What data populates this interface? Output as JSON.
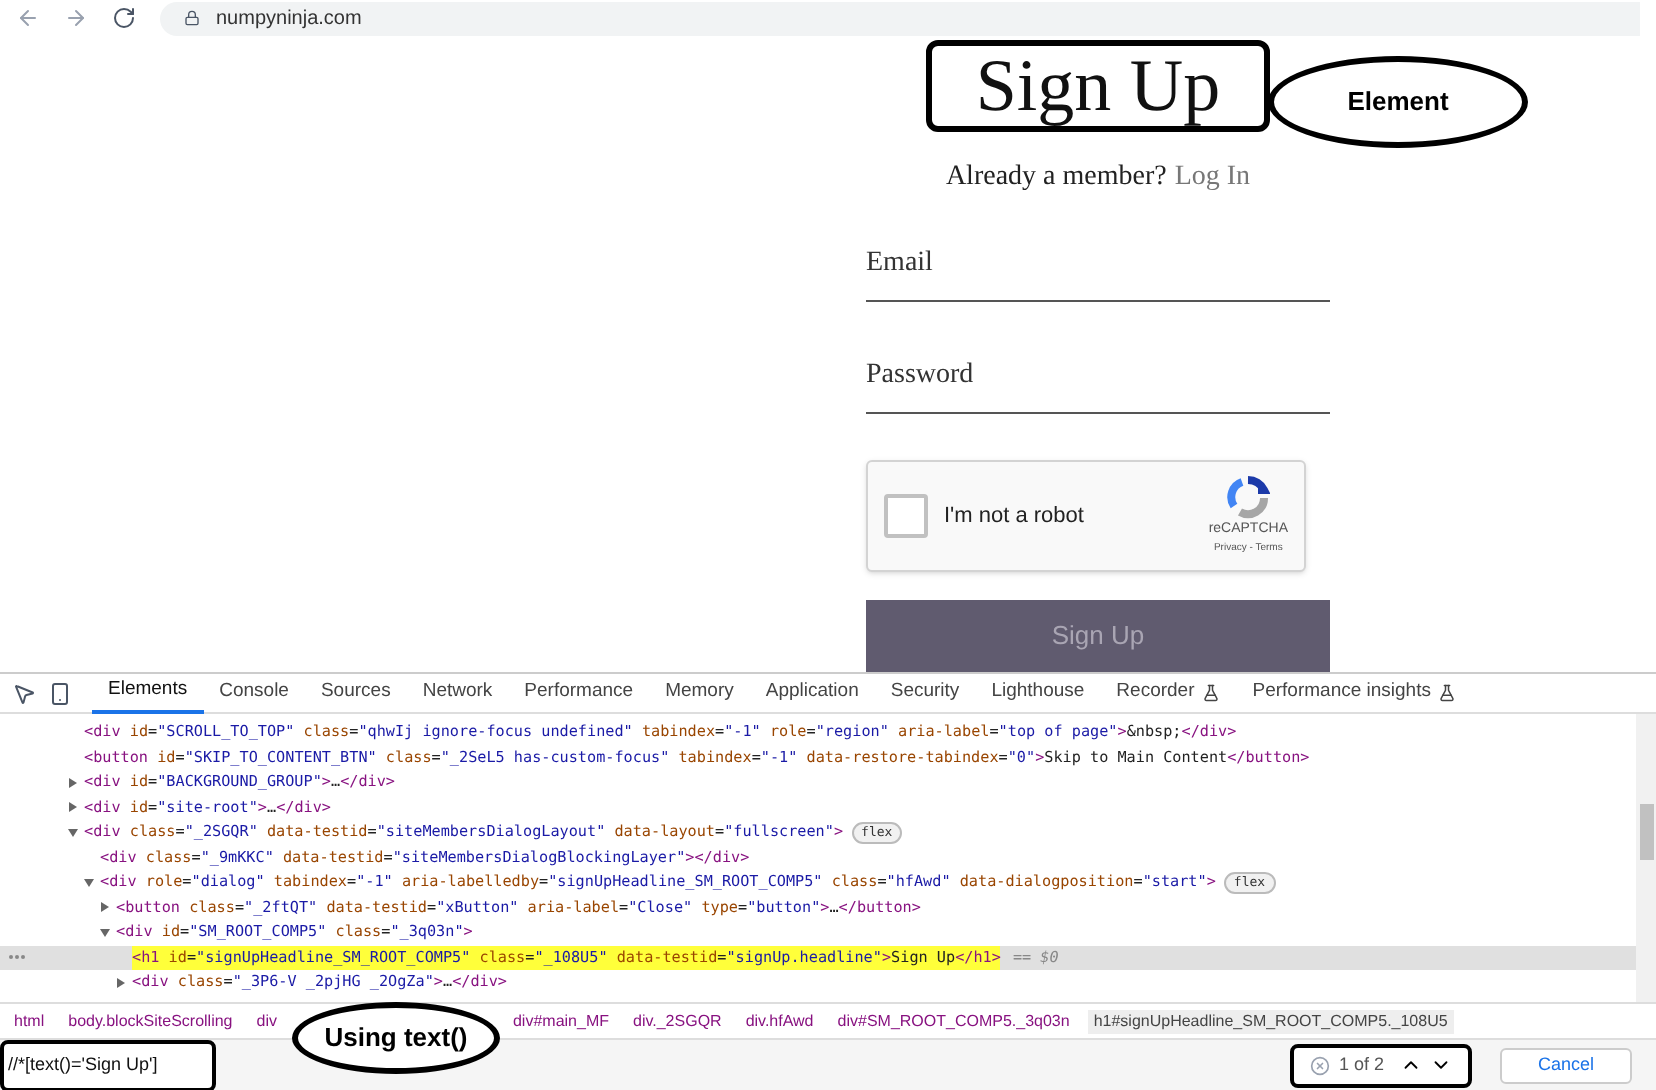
{
  "browser": {
    "url": "numpyninja.com"
  },
  "page": {
    "title": "Sign Up",
    "member_prompt": "Already a member?",
    "login_link": "Log In",
    "fields": [
      {
        "label": "Email"
      },
      {
        "label": "Password"
      }
    ],
    "captcha": {
      "label": "I'm not a robot",
      "checked": false,
      "brand": "reCAPTCHA",
      "links": "Privacy - Terms"
    },
    "submit": "Sign Up"
  },
  "devtools": {
    "tabs": [
      {
        "label": "Elements",
        "selected": true,
        "flask": false
      },
      {
        "label": "Console",
        "selected": false,
        "flask": false
      },
      {
        "label": "Sources",
        "selected": false,
        "flask": false
      },
      {
        "label": "Network",
        "selected": false,
        "flask": false
      },
      {
        "label": "Performance",
        "selected": false,
        "flask": false
      },
      {
        "label": "Memory",
        "selected": false,
        "flask": false
      },
      {
        "label": "Application",
        "selected": false,
        "flask": false
      },
      {
        "label": "Security",
        "selected": false,
        "flask": false
      },
      {
        "label": "Lighthouse",
        "selected": false,
        "flask": false
      },
      {
        "label": "Recorder",
        "selected": false,
        "flask": true
      },
      {
        "label": "Performance insights",
        "selected": false,
        "flask": true
      }
    ],
    "lines": [
      {
        "code": "<div id=\"SCROLL_TO_TOP\" class=\"qhwIj ignore-focus undefined\" tabindex=\"-1\" role=\"region\" aria-label=\"top of page\">&nbsp;</div>",
        "selected": false
      },
      {
        "code": "<button id=\"SKIP_TO_CONTENT_BTN\" class=\"_2SeL5 has-custom-focus\" tabindex=\"-1\" data-restore-tabindex=\"0\">Skip to Main Content</button>",
        "selected": false
      },
      {
        "code": "<div id=\"BACKGROUND_GROUP\">…</div>",
        "expanded": false,
        "selected": false
      },
      {
        "code": "<div id=\"site-root\">…</div>",
        "expanded": false,
        "selected": false
      },
      {
        "code": "<div class=\"_2SGQR\" data-testid=\"siteMembersDialogLayout\" data-layout=\"fullscreen\">",
        "badge": "flex",
        "expanded": true,
        "selected": false,
        "children": [
          {
            "code": "<div class=\"_9mKKC\" data-testid=\"siteMembersDialogBlockingLayer\"></div>",
            "selected": false
          },
          {
            "code": "<div role=\"dialog\" tabindex=\"-1\" aria-labelledby=\"signUpHeadline_SM_ROOT_COMP5\" class=\"hfAwd\" data-dialogposition=\"start\">",
            "badge": "flex",
            "expanded": true,
            "selected": false,
            "children": [
              {
                "code": "<button class=\"_2ftQT\" data-testid=\"xButton\" aria-label=\"Close\" type=\"button\">…</button>",
                "expanded": false,
                "selected": false
              },
              {
                "code": "<div id=\"SM_ROOT_COMP5\" class=\"_3q03n\">",
                "expanded": true,
                "selected": false,
                "children": [
                  {
                    "code": "<h1 id=\"signUpHeadline_SM_ROOT_COMP5\" class=\"_108U5\" data-testid=\"signUp.headline\">Sign Up</h1>",
                    "suffix": "== $0",
                    "selected": true
                  },
                  {
                    "code": "<div class=\"_3P6-V _2pjHG _2OgZa\">…</div>",
                    "expanded": false,
                    "selected": false
                  }
                ]
              }
            ]
          }
        ]
      }
    ],
    "breadcrumbs": [
      {
        "label": "html",
        "selected": false
      },
      {
        "label": "body.blockSiteScrolling",
        "selected": false
      },
      {
        "label": "div",
        "selected": false
      },
      {
        "label": "div#main_MF",
        "selected": false
      },
      {
        "label": "div._2SGQR",
        "selected": false
      },
      {
        "label": "div.hfAwd",
        "selected": false
      },
      {
        "label": "div#SM_ROOT_COMP5._3q03n",
        "selected": false
      },
      {
        "label": "h1#signUpHeadline_SM_ROOT_COMP5._108U5",
        "selected": true
      }
    ],
    "search": {
      "value": "//*[text()='Sign Up']",
      "match_count": "1 of 2",
      "cancel": "Cancel"
    }
  },
  "annotations": [
    {
      "text": "Element"
    },
    {
      "text": "Using text()"
    }
  ]
}
